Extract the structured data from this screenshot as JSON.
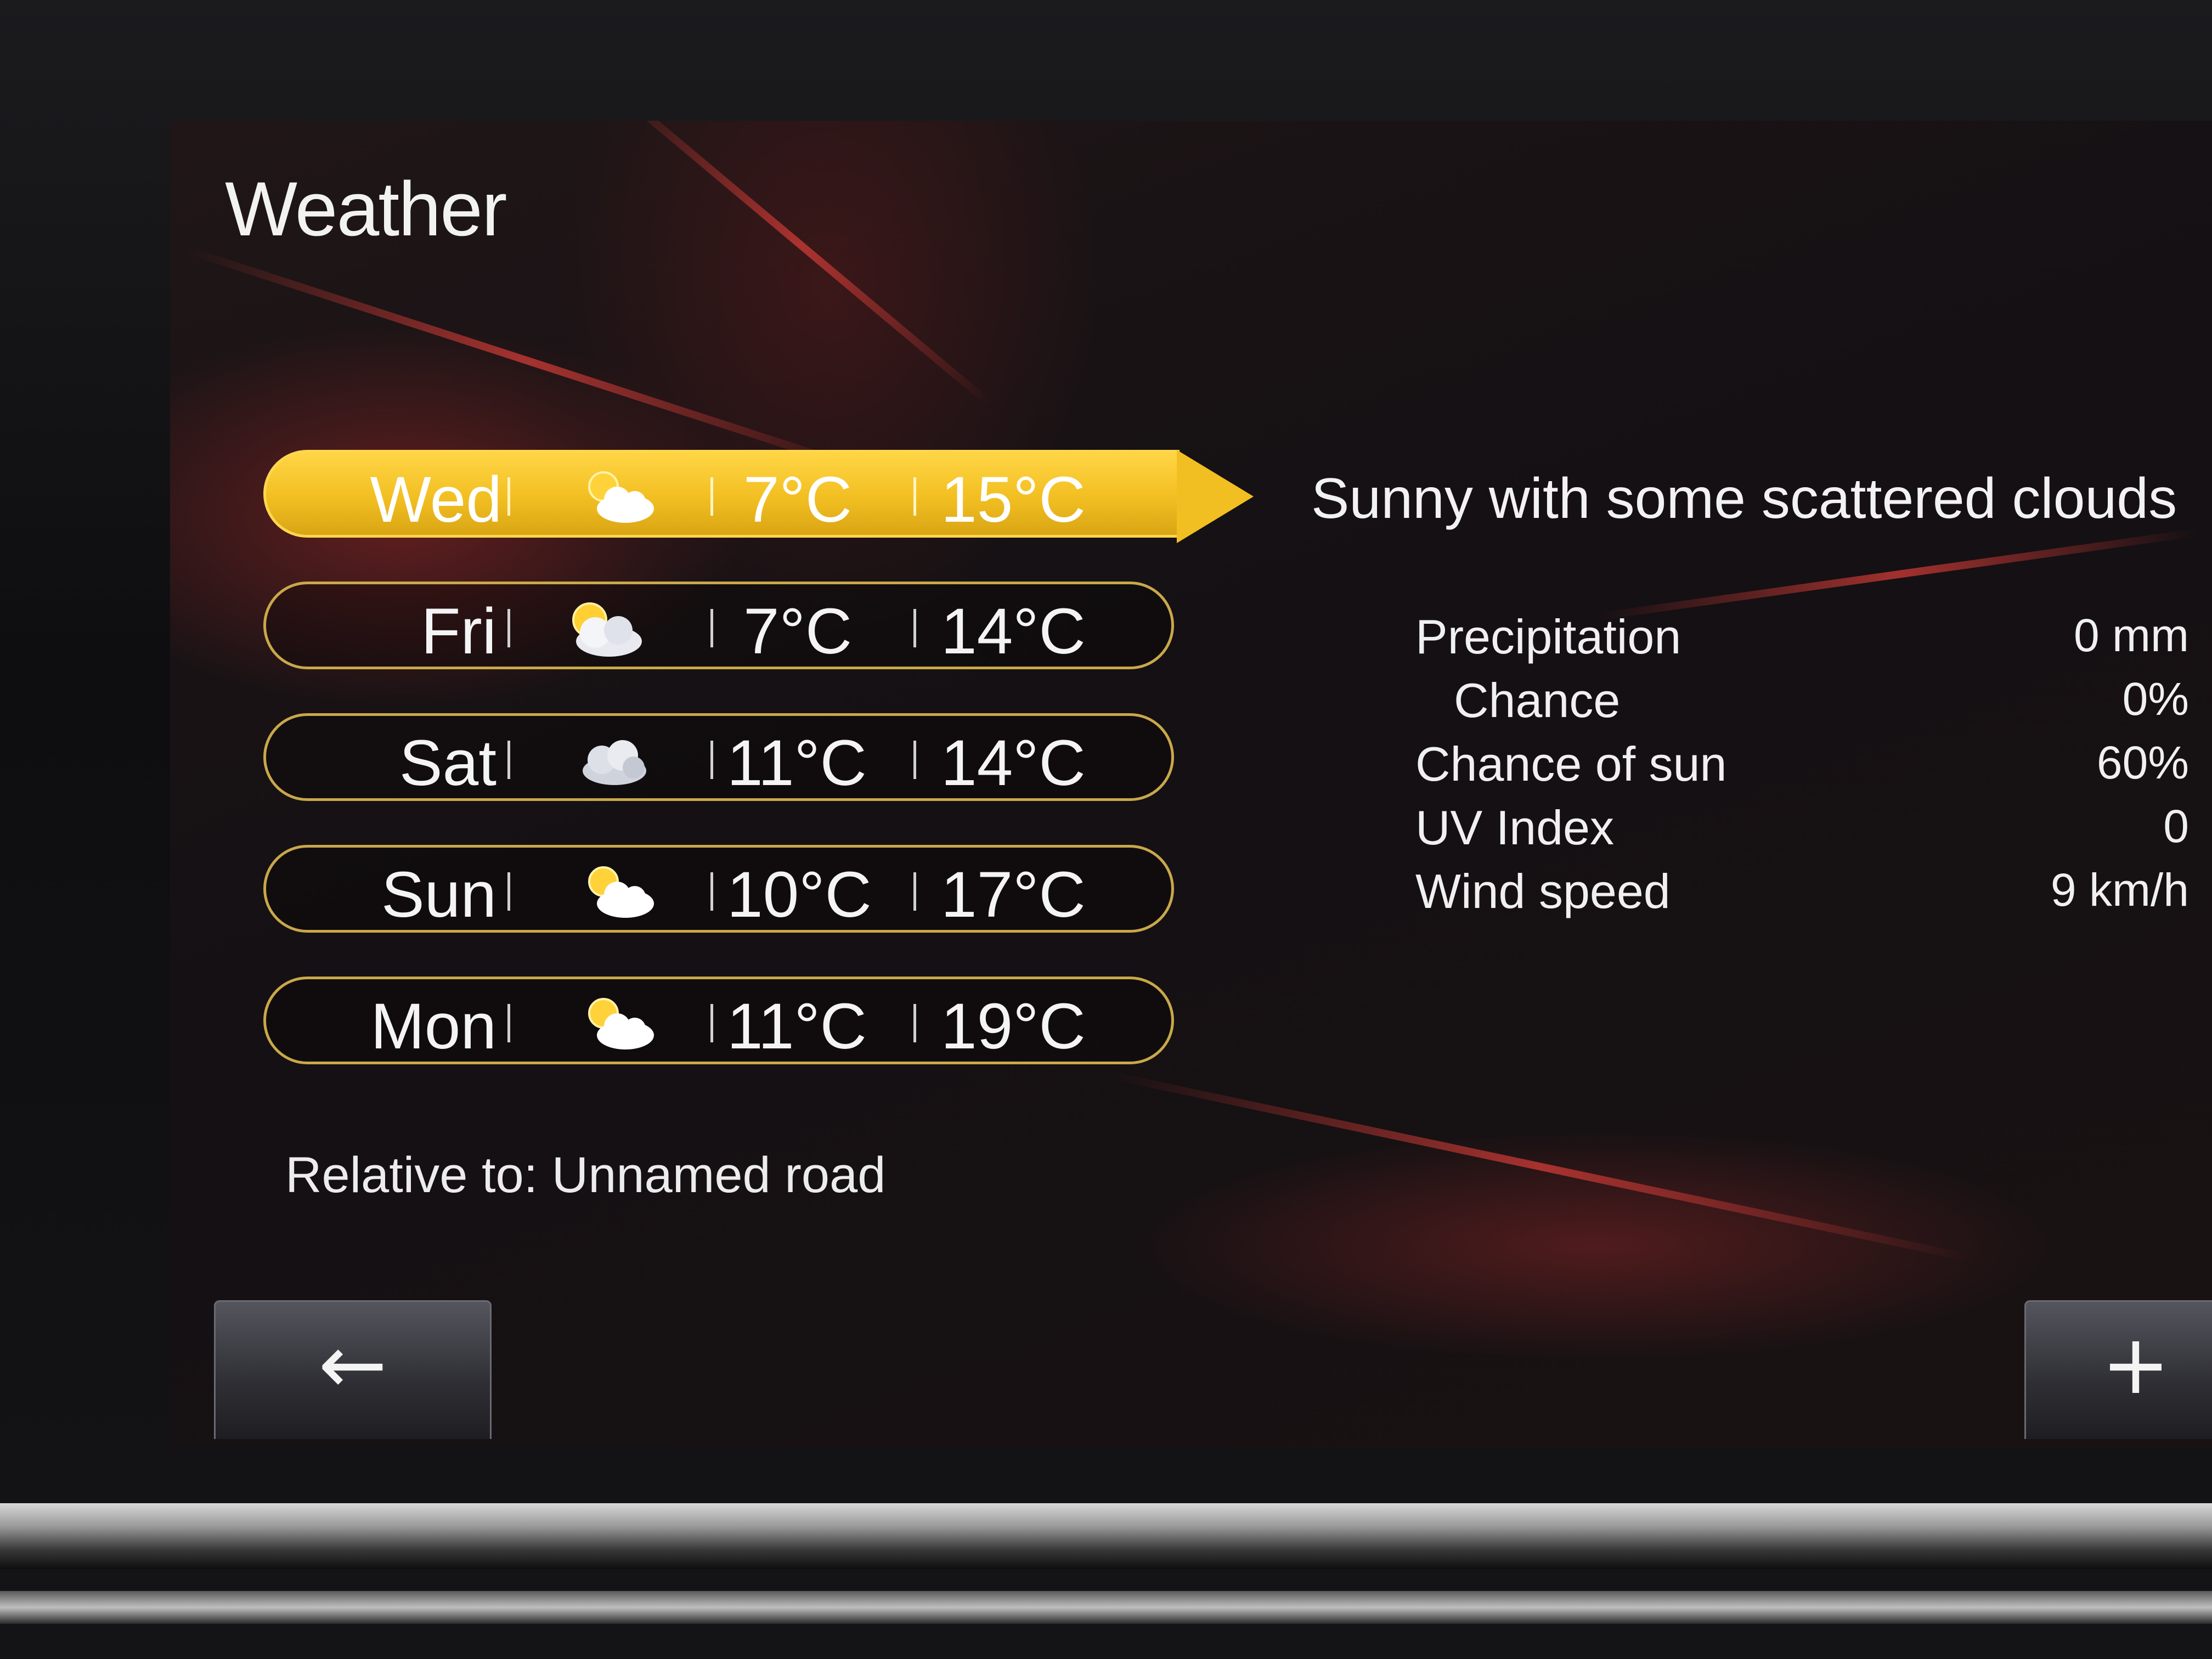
{
  "screen": {
    "title": "Weather"
  },
  "forecast": [
    {
      "day": "Wed",
      "icon": "sun-cloud-icon",
      "low": "7°C",
      "high": "15°C",
      "selected": true
    },
    {
      "day": "Fri",
      "icon": "sun-behind-clouds-icon",
      "low": "7°C",
      "high": "14°C",
      "selected": false
    },
    {
      "day": "Sat",
      "icon": "clouds-icon",
      "low": "11°C",
      "high": "14°C",
      "selected": false
    },
    {
      "day": "Sun",
      "icon": "sun-cloud-icon",
      "low": "10°C",
      "high": "17°C",
      "selected": false
    },
    {
      "day": "Mon",
      "icon": "sun-cloud-icon",
      "low": "11°C",
      "high": "19°C",
      "selected": false
    }
  ],
  "selected_day": {
    "summary": "Sunny with some scattered clouds",
    "details": [
      {
        "label": "Precipitation",
        "value": "0 mm"
      },
      {
        "label": "Chance",
        "value": "0%"
      },
      {
        "label": "Chance of sun",
        "value": "60%"
      },
      {
        "label": "UV Index",
        "value": "0"
      },
      {
        "label": "Wind speed",
        "value": "9 km/h"
      }
    ]
  },
  "location": {
    "text": "Relative to: Unnamed road"
  },
  "buttons": {
    "back_label": "←",
    "add_label": "+"
  },
  "colors": {
    "accent_yellow": "#f2bf22",
    "row_border": "#c9a84a",
    "text": "#f2f2f2"
  }
}
